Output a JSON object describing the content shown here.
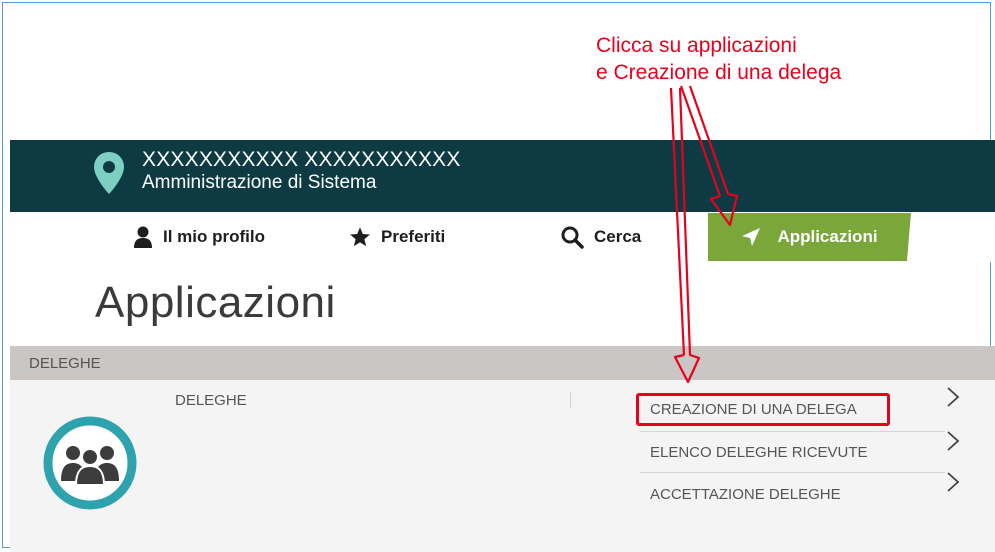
{
  "annotation": {
    "line1": "Clicca su applicazioni",
    "line2": "e Creazione di una delega"
  },
  "header": {
    "org_name": "XXXXXXXXXXX XXXXXXXXXXX",
    "org_subtitle": "Amministrazione di Sistema"
  },
  "nav": {
    "profile": "Il mio profilo",
    "favorites": "Preferiti",
    "search": "Cerca",
    "applications": "Applicazioni"
  },
  "page": {
    "title": "Applicazioni"
  },
  "section": {
    "bar_label": "DELEGHE",
    "card_title": "DELEGHE",
    "links": [
      "CREAZIONE DI UNA DELEGA",
      "ELENCO DELEGHE RICEVUTE",
      "ACCETTAZIONE DELEGHE"
    ]
  },
  "colors": {
    "banner": "#0e3b43",
    "accent_green": "#7aa63a",
    "teal_icon": "#2fa3ad",
    "annotation_red": "#e8001c",
    "section_bar": "#c9c6c3"
  },
  "icons": {
    "location": "map-pin-icon",
    "profile": "user-icon",
    "favorites": "star-icon",
    "search": "search-icon",
    "applications": "paper-plane-icon",
    "group": "users-group-icon",
    "chevron": "chevron-right-icon"
  }
}
